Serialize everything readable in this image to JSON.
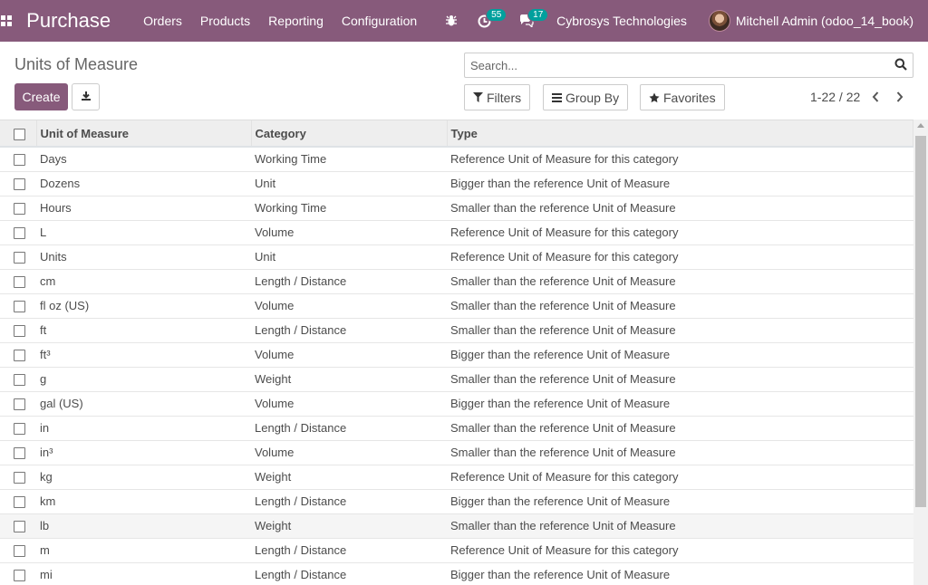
{
  "navbar": {
    "app_name": "Purchase",
    "menus": [
      "Orders",
      "Products",
      "Reporting",
      "Configuration"
    ],
    "activity_badge": "55",
    "messages_badge": "17",
    "company": "Cybrosys Technologies",
    "user": "Mitchell Admin (odoo_14_book)"
  },
  "page": {
    "title": "Units of Measure"
  },
  "search": {
    "placeholder": "Search..."
  },
  "actions": {
    "create_label": "Create"
  },
  "filters": {
    "filters_label": "Filters",
    "groupby_label": "Group By",
    "favorites_label": "Favorites"
  },
  "pager": {
    "value": "1-22 / 22"
  },
  "table": {
    "headers": [
      "Unit of Measure",
      "Category",
      "Type"
    ],
    "rows": [
      [
        "Days",
        "Working Time",
        "Reference Unit of Measure for this category"
      ],
      [
        "Dozens",
        "Unit",
        "Bigger than the reference Unit of Measure"
      ],
      [
        "Hours",
        "Working Time",
        "Smaller than the reference Unit of Measure"
      ],
      [
        "L",
        "Volume",
        "Reference Unit of Measure for this category"
      ],
      [
        "Units",
        "Unit",
        "Reference Unit of Measure for this category"
      ],
      [
        "cm",
        "Length / Distance",
        "Smaller than the reference Unit of Measure"
      ],
      [
        "fl oz (US)",
        "Volume",
        "Smaller than the reference Unit of Measure"
      ],
      [
        "ft",
        "Length / Distance",
        "Smaller than the reference Unit of Measure"
      ],
      [
        "ft³",
        "Volume",
        "Bigger than the reference Unit of Measure"
      ],
      [
        "g",
        "Weight",
        "Smaller than the reference Unit of Measure"
      ],
      [
        "gal (US)",
        "Volume",
        "Bigger than the reference Unit of Measure"
      ],
      [
        "in",
        "Length / Distance",
        "Smaller than the reference Unit of Measure"
      ],
      [
        "in³",
        "Volume",
        "Smaller than the reference Unit of Measure"
      ],
      [
        "kg",
        "Weight",
        "Reference Unit of Measure for this category"
      ],
      [
        "km",
        "Length / Distance",
        "Bigger than the reference Unit of Measure"
      ],
      [
        "lb",
        "Weight",
        "Smaller than the reference Unit of Measure"
      ],
      [
        "m",
        "Length / Distance",
        "Reference Unit of Measure for this category"
      ],
      [
        "mi",
        "Length / Distance",
        "Bigger than the reference Unit of Measure"
      ]
    ]
  },
  "colors": {
    "brand": "#875a7b",
    "badge": "#00a09d"
  }
}
